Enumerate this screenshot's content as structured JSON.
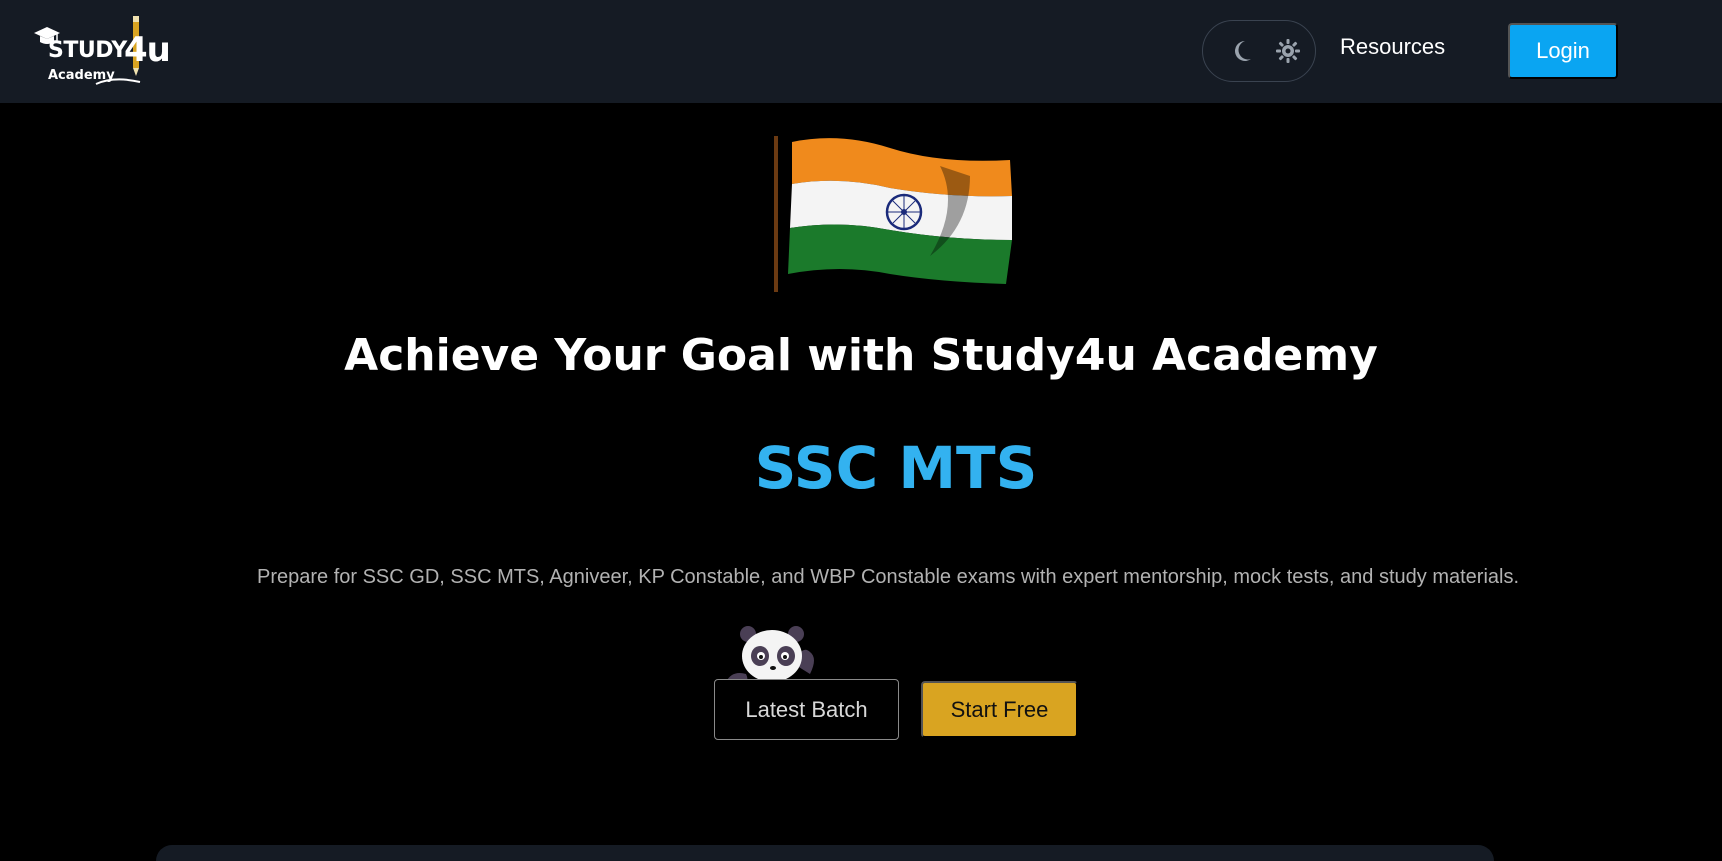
{
  "navbar": {
    "logo": {
      "line1": "STUDY",
      "suffix": "4u",
      "line2": "Academy"
    },
    "theme_toggle": {
      "dark_icon": "moon-icon",
      "light_icon": "sun-icon"
    },
    "resources_label": "Resources",
    "login_label": "Login"
  },
  "hero": {
    "headline": "Achieve Your Goal with Study4u Academy",
    "highlight": "SSC MTS",
    "subtitle": "Prepare for SSC GD, SSC MTS, Agniveer, KP Constable, and WBP Constable exams with expert mentorship, mock tests, and study materials.",
    "latest_batch_label": "Latest Batch",
    "start_free_label": "Start Free"
  },
  "colors": {
    "navbar_bg": "#151b24",
    "accent_blue": "#0aa5f2",
    "highlight_blue": "#33b2f0",
    "start_button": "#d9a421"
  }
}
